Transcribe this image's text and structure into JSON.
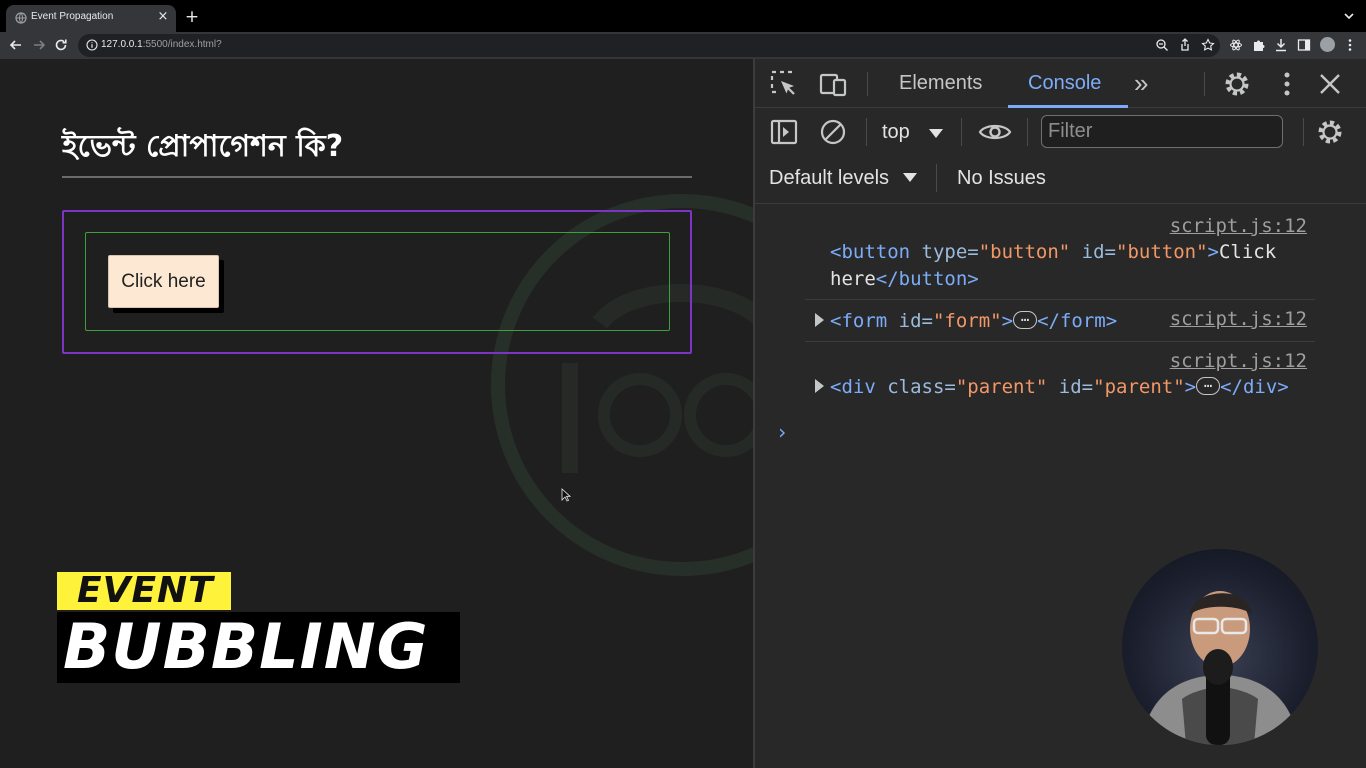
{
  "browser": {
    "tab_title": "Event Propagation",
    "tab_close_glyph": "×",
    "new_tab_glyph": "+",
    "url_host": "127.0.0.1",
    "url_path": ":5500/index.html?"
  },
  "page": {
    "heading": "ইভেন্ট প্রোপাগেশন কি?",
    "button_label": "Click here",
    "colors": {
      "parent_border": "#7b34c4",
      "form_border": "#3ca13a",
      "button_bg": "#fde9d3"
    }
  },
  "overlay": {
    "event_label": "EVENT",
    "bubbling_label": "BUBBLING",
    "event_bg": "#fff23a"
  },
  "devtools": {
    "tabs": [
      {
        "label": "Elements",
        "active": false
      },
      {
        "label": "Console",
        "active": true
      }
    ],
    "more_tabs_glyph": "»",
    "context": "top",
    "filter_placeholder": "Filter",
    "levels": "Default levels",
    "issues": "No Issues",
    "prompt_glyph": "›",
    "messages": [
      {
        "source": "script.js:12",
        "line1": {
          "open": "<button",
          "attr1": " type=",
          "val1": "\"button\"",
          "attr2": " id=",
          "val2": "\"button\"",
          "close": ">",
          "text": "Click"
        },
        "line2": {
          "text": "here",
          "end": "</button>"
        }
      },
      {
        "source": "script.js:12",
        "line": {
          "open": "<form",
          "attr1": " id=",
          "val1": "\"form\"",
          "close": ">",
          "ellipsis": "…",
          "end": "</form>"
        }
      },
      {
        "source": "script.js:12",
        "line": {
          "open": "<div",
          "attr1": " class=",
          "val1": "\"parent\"",
          "attr2": " id=",
          "val2": "\"parent\"",
          "close": ">",
          "ellipsis": "…",
          "end": "</div>"
        }
      }
    ]
  }
}
